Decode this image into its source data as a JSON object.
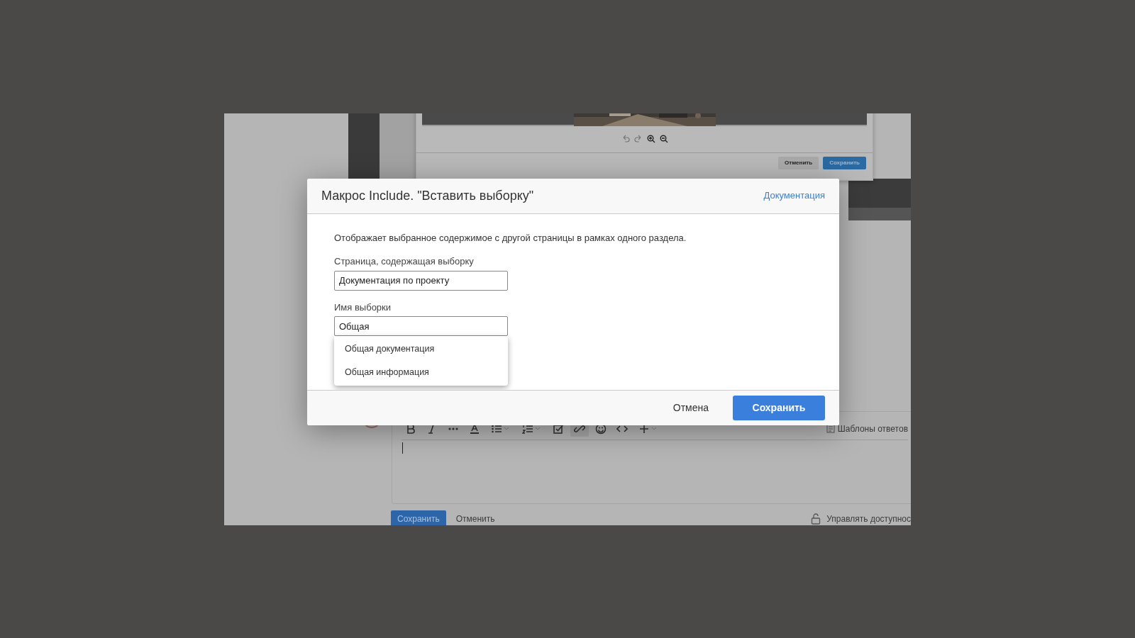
{
  "background_app": {
    "image_editor": {
      "buttons": [
        {
          "label": "Отменить",
          "kind": "secondary"
        },
        {
          "label": "Сохранить",
          "kind": "primary"
        }
      ]
    },
    "comment_editor": {
      "toolbar": [
        {
          "kind": "bold",
          "active": false
        },
        {
          "kind": "italic",
          "active": false
        },
        {
          "kind": "more",
          "active": false
        },
        {
          "kind": "text-color",
          "active": false
        },
        {
          "kind": "bullet-list",
          "active": false
        },
        {
          "kind": "numbered-list",
          "active": false
        },
        {
          "kind": "checklist",
          "active": false
        },
        {
          "kind": "link",
          "active": true
        },
        {
          "kind": "emoji",
          "active": false
        },
        {
          "kind": "code",
          "active": false
        },
        {
          "kind": "insert",
          "active": false
        }
      ],
      "templates_link": "Шаблоны ответов",
      "buttons": [
        {
          "label": "Сохранить",
          "kind": "primary"
        },
        {
          "label": "Отменить",
          "kind": "secondary"
        }
      ],
      "access_link": "Управлять доступнос"
    }
  },
  "dialog": {
    "title": "Макрос Include. \"Вставить выборку\"",
    "doc_link": "Документация",
    "description": "Отображает выбранное содержимое с другой страницы в рамках одного раздела.",
    "fields": [
      {
        "label": "Страница, содержащая выборку",
        "value": "Документация по проекту"
      },
      {
        "label": "Имя выборки",
        "value": "Общая"
      }
    ],
    "suggestions": [
      "Общая документация",
      "Общая информация"
    ],
    "buttons": [
      {
        "label": "Отмена",
        "kind": "secondary"
      },
      {
        "label": "Сохранить",
        "kind": "primary"
      }
    ]
  }
}
